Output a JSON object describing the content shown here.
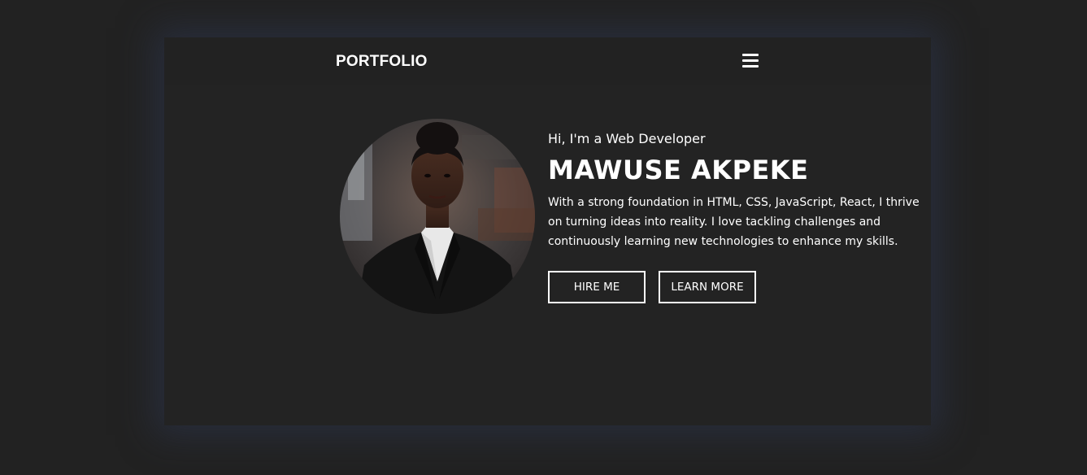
{
  "navbar": {
    "brand": "PORTFOLIO",
    "menu_icon": "hamburger-menu-icon"
  },
  "hero": {
    "greeting": "Hi, I'm a Web Developer",
    "name": "MAWUSE AKPEKE",
    "bio": "With a strong foundation in HTML, CSS, JavaScript, React, I thrive on turning ideas into reality. I love tackling challenges and continuously learning new technologies to enhance my skills.",
    "buttons": {
      "hire": "HIRE ME",
      "learn": "LEARN MORE"
    }
  },
  "colors": {
    "background": "#222222",
    "text": "#ffffff",
    "glow": "#2d3750"
  }
}
